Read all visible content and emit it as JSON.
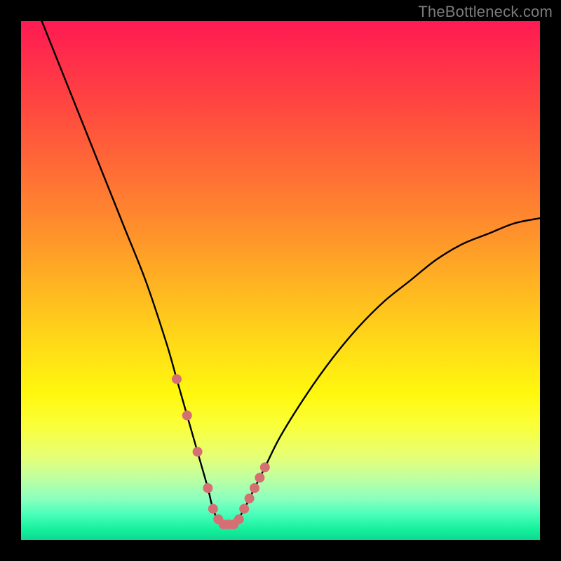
{
  "watermark": "TheBottleneck.com",
  "chart_data": {
    "type": "line",
    "title": "",
    "xlabel": "",
    "ylabel": "",
    "xlim": [
      0,
      100
    ],
    "ylim": [
      0,
      100
    ],
    "series": [
      {
        "name": "bottleneck-curve",
        "x": [
          0,
          4,
          8,
          12,
          16,
          20,
          24,
          28,
          30,
          32,
          34,
          36,
          37,
          38.5,
          41,
          43,
          45,
          47,
          50,
          55,
          60,
          65,
          70,
          75,
          80,
          85,
          90,
          95,
          100
        ],
        "values": [
          110,
          100,
          90,
          80,
          70,
          60,
          50,
          38,
          31,
          24,
          17,
          10,
          6,
          3,
          3,
          6,
          10,
          14,
          20,
          28,
          35,
          41,
          46,
          50,
          54,
          57,
          59,
          61,
          62
        ]
      }
    ],
    "highlight_points": {
      "name": "sweet-spot",
      "color": "#d66f74",
      "x": [
        30,
        32,
        34,
        36,
        37,
        38,
        39,
        40,
        41,
        42,
        43,
        44,
        45,
        46,
        47
      ],
      "values": [
        31,
        24,
        17,
        10,
        6,
        4,
        3,
        3,
        3,
        4,
        6,
        8,
        10,
        12,
        14
      ]
    },
    "gradient_stops": [
      {
        "pos": 0,
        "color": "#ff1a53"
      },
      {
        "pos": 16,
        "color": "#ff4640"
      },
      {
        "pos": 40,
        "color": "#ff8f2c"
      },
      {
        "pos": 64,
        "color": "#ffe016"
      },
      {
        "pos": 84,
        "color": "#e6ff76"
      },
      {
        "pos": 95,
        "color": "#4affba"
      },
      {
        "pos": 100,
        "color": "#0fd893"
      }
    ]
  }
}
